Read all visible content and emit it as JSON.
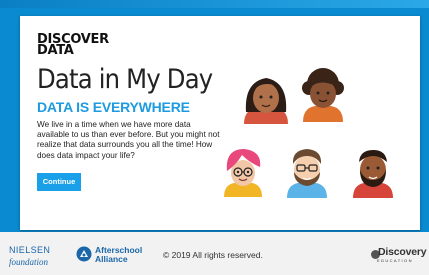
{
  "card": {
    "logo_line1": "DISCOVER",
    "logo_line2": "DATA",
    "title": "Data in My Day",
    "subtitle": "DATA IS EVERYWHERE",
    "body": "We live in a time when we have more data available to us than ever before. But you might not realize that data surrounds you all the time! How does data impact your life?",
    "button_label": "Continue"
  },
  "avatars": [
    {
      "name": "avatar-woman-dark-hair"
    },
    {
      "name": "avatar-person-curly-hair"
    },
    {
      "name": "avatar-woman-pink-hair"
    },
    {
      "name": "avatar-man-glasses"
    },
    {
      "name": "avatar-man-beard"
    }
  ],
  "footer": {
    "nielsen_line1": "NIELSEN",
    "nielsen_line2": "foundation",
    "afterschool_line1": "Afterschool",
    "afterschool_line2": "Alliance",
    "copyright": "© 2019 All rights reserved.",
    "discovery_line1": "Discovery",
    "discovery_line2": "EDUCATION"
  },
  "colors": {
    "background": "#0a8ad0",
    "accent": "#1e9be0",
    "button": "#1aa0e8",
    "footer": "#f2f2f2"
  }
}
